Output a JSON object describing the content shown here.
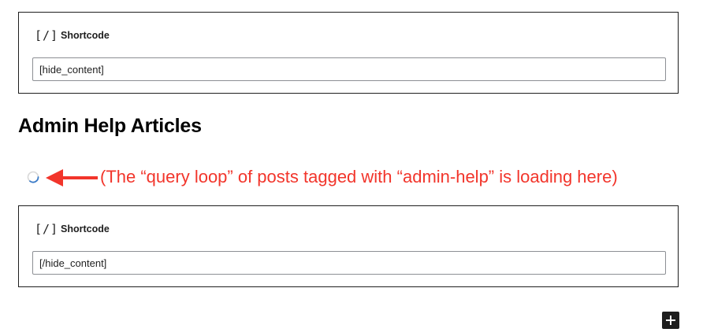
{
  "shortcode_block_top": {
    "icon": "shortcode-icon",
    "icon_glyph": "[/]",
    "label": "Shortcode",
    "value": "[hide_content]"
  },
  "heading": "Admin Help Articles",
  "loading": {
    "icon": "spinner-icon",
    "annotation": "(The “query loop” of posts tagged with “admin-help” is loading here)",
    "annotation_color": "#f2352b"
  },
  "shortcode_block_bottom": {
    "icon": "shortcode-icon",
    "icon_glyph": "[/]",
    "label": "Shortcode",
    "value": "[/hide_content]"
  },
  "inserter": {
    "icon": "plus-icon"
  }
}
